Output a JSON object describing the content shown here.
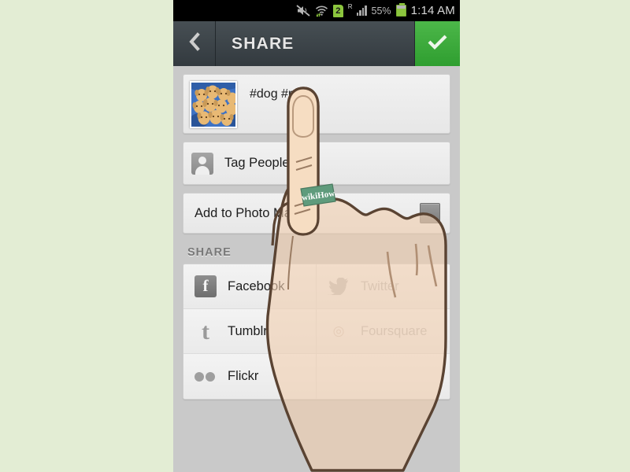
{
  "page": {
    "background_color": "#e3edd4",
    "screen_background": "#c9c9c9"
  },
  "statusbar": {
    "mute_icon": "mute-icon",
    "wifi_icon": "wifi-transfer-icon",
    "sim_badge": "2",
    "roaming_label": "R",
    "signal_icon": "signal-bars-icon",
    "battery_percent": "55%",
    "battery_icon": "battery-icon",
    "time": "1:14 AM"
  },
  "actionbar": {
    "back_icon": "chevron-left-icon",
    "title": "SHARE",
    "confirm_icon": "check-icon",
    "confirm_color": "#3aa93a"
  },
  "content": {
    "caption": {
      "thumbnail_name": "photo-thumbnail",
      "text": "#dog #pet"
    },
    "tag_people": {
      "icon": "person-card-icon",
      "label": "Tag People"
    },
    "photo_map": {
      "label": "Add to Photo Map",
      "toggle_state": "off",
      "toggle_name": "photo-map-toggle"
    },
    "share_section": {
      "header": "SHARE",
      "services": [
        {
          "label": "Facebook",
          "icon": "facebook-icon",
          "enabled": true
        },
        {
          "label": "Twitter",
          "icon": "twitter-icon",
          "enabled": true
        },
        {
          "label": "Tumblr",
          "icon": "tumblr-icon",
          "enabled": true
        },
        {
          "label": "Foursquare",
          "icon": "foursquare-icon",
          "enabled": true
        },
        {
          "label": "Flickr",
          "icon": "flickr-icon",
          "enabled": true
        },
        {
          "label": "",
          "icon": "",
          "enabled": false
        }
      ]
    }
  },
  "overlay": {
    "hand_name": "pointing-hand-illustration",
    "watermark": "wikiHow",
    "watermark_color": "#4e8a6c"
  }
}
